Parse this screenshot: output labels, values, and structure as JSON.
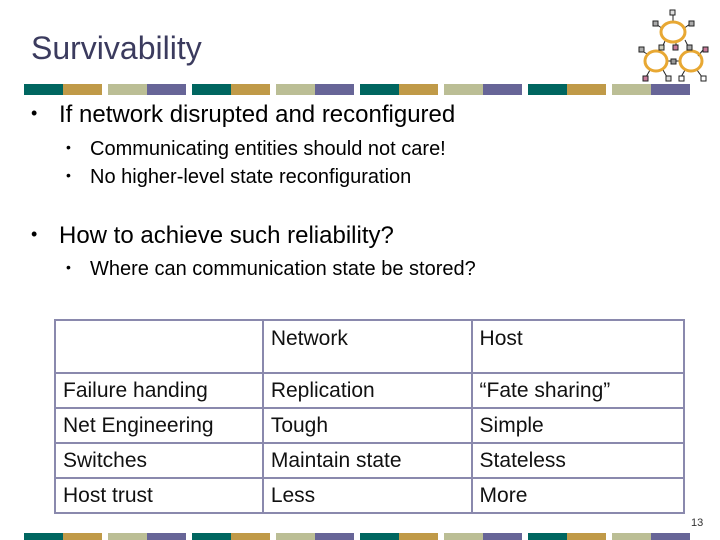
{
  "slide": {
    "title": "Survivability",
    "page_number": "13",
    "logo_icon": "network-rings-logo",
    "stripe_colors": [
      "#006660",
      "#c09a48",
      "#bbbe95",
      "#676597"
    ]
  },
  "bullets": [
    {
      "level": 1,
      "text": "If network disrupted and reconfigured"
    },
    {
      "level": 2,
      "text": "Communicating entities should not care!"
    },
    {
      "level": 2,
      "text": "No higher-level state reconfiguration"
    },
    {
      "level": 1,
      "text": "How to achieve such reliability?"
    },
    {
      "level": 2,
      "text": "Where can communication state be stored?"
    }
  ],
  "table": {
    "headers": [
      "",
      "Network",
      "Host"
    ],
    "rows": [
      [
        "Failure handing",
        "Replication",
        "“Fate sharing”"
      ],
      [
        "Net Engineering",
        "Tough",
        "Simple"
      ],
      [
        "Switches",
        "Maintain state",
        "Stateless"
      ],
      [
        "Host trust",
        "Less",
        "More"
      ]
    ]
  }
}
